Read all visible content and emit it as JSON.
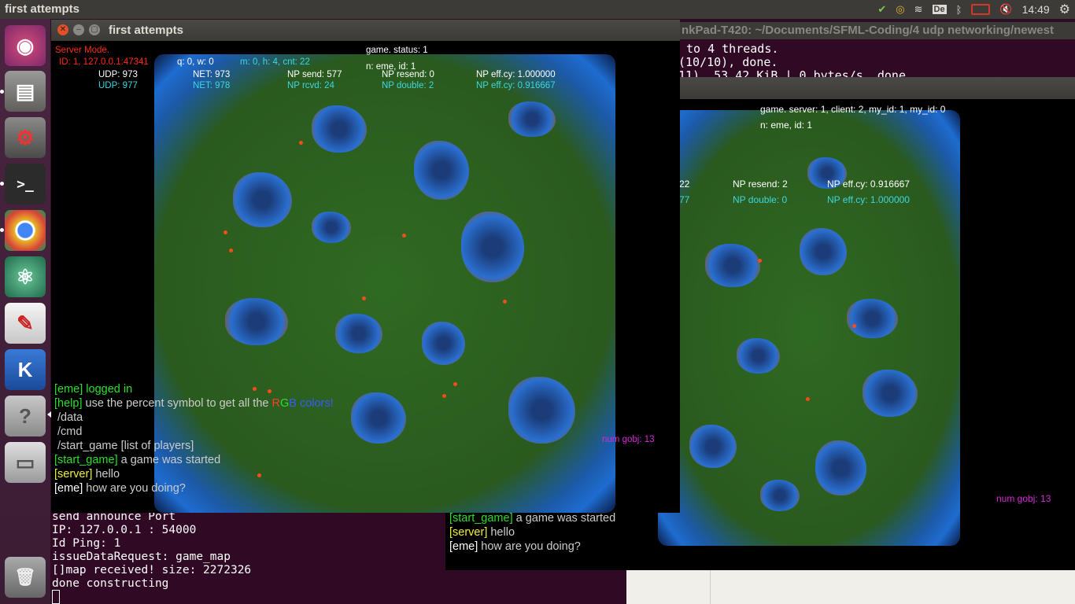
{
  "topbar": {
    "window_title": "first attempts",
    "keyboard_layout": "De",
    "clock": "14:49"
  },
  "launcher": {
    "items": [
      {
        "name": "ubuntu-dash",
        "glyph": "◉"
      },
      {
        "name": "files",
        "glyph": "▤"
      },
      {
        "name": "system-settings",
        "glyph": "⚙"
      },
      {
        "name": "terminal",
        "glyph": ">_"
      },
      {
        "name": "chrome",
        "glyph": "◎"
      },
      {
        "name": "atom",
        "glyph": "⚛"
      },
      {
        "name": "document-viewer",
        "glyph": "✎"
      },
      {
        "name": "kile",
        "glyph": "K"
      },
      {
        "name": "help",
        "glyph": "?"
      },
      {
        "name": "drive",
        "glyph": "▭"
      },
      {
        "name": "trash",
        "glyph": "🗑"
      }
    ]
  },
  "terminal_back": {
    "title": "nkPad-T420: ~/Documents/SFML-Coding/4 udp networking/newest",
    "lines": [
      "to 4 threads.",
      "(10/10), done.",
      "11), 53.42 KiB | 0 bytes/s, done."
    ]
  },
  "terminal_front": {
    "lines": [
      "send announce Port",
      "IP: 127.0.0.1 : 54000",
      "Id Ping: 1",
      "issueDataRequest: game_map",
      "[]map received! size: 2272326",
      "done constructing"
    ]
  },
  "server_window": {
    "title": "first attempts",
    "hud": {
      "mode": "Server Mode.",
      "id_line": "ID: 1, 127.0.0.1:47341",
      "qw": "q: 0, w: 0",
      "mh": "m: 0, h: 4, cnt: 22",
      "status": "game. status: 1",
      "name": "n: eme, id: 1",
      "udp_w": "UDP: 973",
      "udp_c": "UDP: 977",
      "net_w": "NET: 973",
      "net_c": "NET: 978",
      "np_send": "NP send: 577",
      "np_rcvd": "NP rcvd: 24",
      "np_resend": "NP resend: 0",
      "np_double": "NP double: 2",
      "np_eff_w": "NP eff.cy: 1.000000",
      "np_eff_c": "NP eff.cy: 0.916667",
      "num_gobj": "num gobj: 13"
    },
    "chat": [
      {
        "tag": "[eme]",
        "text": " logged in"
      },
      {
        "tag": "[help]",
        "text": " use the percent symbol to get all the "
      },
      {
        "tag": "",
        "text": "/data"
      },
      {
        "tag": "",
        "text": "/cmd"
      },
      {
        "tag": "",
        "text": "/start_game [list of players]"
      },
      {
        "tag": "[start_game]",
        "text": " a game was started"
      },
      {
        "tag": "[server]",
        "text": " hello"
      },
      {
        "tag": "[eme]",
        "text": " how are you doing?"
      }
    ],
    "rgb": {
      "r": "R",
      "g": "G",
      "b": "B",
      "rest": " colors!"
    }
  },
  "client_window": {
    "hud": {
      "status": "game. server: 1, client: 2, my_id: 1, my_id: 0",
      "name": "n: eme, id: 1",
      "partial_w": "22",
      "partial_c": "77",
      "np_resend": "NP resend: 2",
      "np_double": "NP double: 0",
      "np_eff_w": "NP eff.cy: 0.916667",
      "np_eff_c": "NP eff.cy: 1.000000",
      "num_gobj": "num gobj: 13"
    },
    "chat": [
      {
        "tag": "[start_game]",
        "text": " a game was started"
      },
      {
        "tag": "[server]",
        "text": " hello"
      },
      {
        "tag": "[eme]",
        "text": " how are you doing?"
      }
    ]
  },
  "colors": {
    "terminal_bg": "#300a24",
    "chat_green": "#29e02d",
    "chat_yellow": "#f2f22a",
    "hud_cyan": "#3fd6e0",
    "hud_red": "#ff2a1a",
    "hud_magenta": "#d62ad6"
  }
}
